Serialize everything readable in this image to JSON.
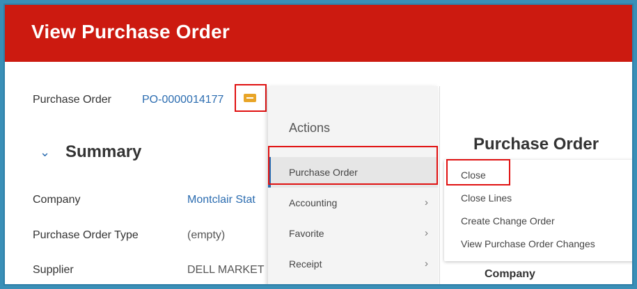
{
  "header": {
    "title": "View Purchase Order"
  },
  "po": {
    "label": "Purchase Order",
    "number": "PO-0000014177"
  },
  "summary": {
    "title": "Summary",
    "fields": [
      {
        "label": "Company",
        "value": "Montclair Stat"
      },
      {
        "label": "Purchase Order Type",
        "value": "(empty)"
      },
      {
        "label": "Supplier",
        "value": "DELL MARKET"
      }
    ]
  },
  "actions_menu": {
    "title": "Actions",
    "items": [
      {
        "label": "Purchase Order"
      },
      {
        "label": "Accounting"
      },
      {
        "label": "Favorite"
      },
      {
        "label": "Receipt"
      }
    ]
  },
  "panel": {
    "title": "Purchase Order",
    "submenu": [
      {
        "label": "Close"
      },
      {
        "label": "Close Lines"
      },
      {
        "label": "Create Change Order"
      },
      {
        "label": "View Purchase Order Changes"
      }
    ],
    "company_label": "Company"
  },
  "colors": {
    "header": "#cc1a10",
    "link": "#2b6cb0",
    "highlight": "#e01010",
    "related_button": "#e8a528"
  }
}
